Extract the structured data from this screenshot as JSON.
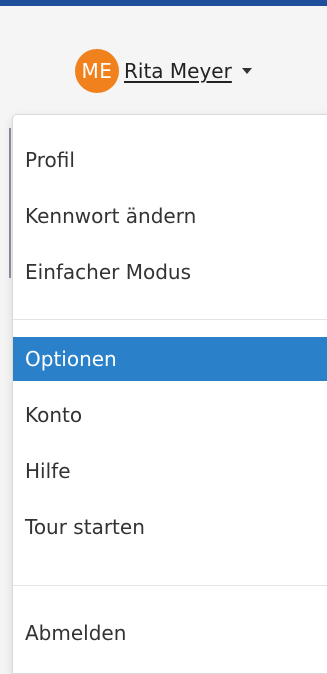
{
  "user": {
    "initials": "ME",
    "name": "Rita Meyer",
    "avatar_color": "#f0811d"
  },
  "menu": {
    "active_color": "#2a80c9",
    "groups": [
      [
        "Profil",
        "Kennwort ändern",
        "Einfacher Modus"
      ],
      [
        "Optionen",
        "Konto",
        "Hilfe",
        "Tour starten"
      ],
      [
        "Abmelden"
      ]
    ],
    "active_item": "Optionen"
  }
}
